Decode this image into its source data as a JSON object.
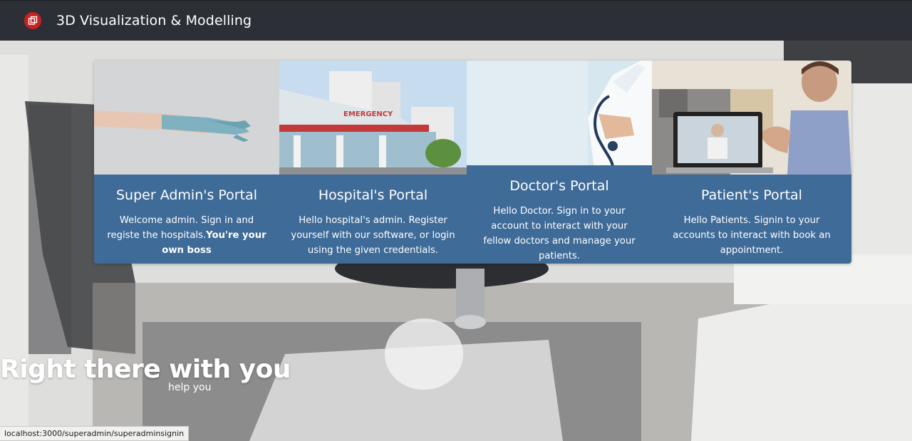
{
  "app": {
    "title": "3D Visualization & Modelling",
    "logo_icon": "cube-icon",
    "accent_color": "#cc1f1f"
  },
  "portals": [
    {
      "title": "Super Admin's Portal",
      "text": "Welcome admin. Sign in and registe the hospitals.",
      "text_bold": "You're your own boss",
      "image": "gloved-hand-image"
    },
    {
      "title": "Hospital's Portal",
      "text": "Hello hospital's admin. Register yourself with our software, or login using the given credentials.",
      "image": "hospital-building-image",
      "sign_text": "EMERGENCY"
    },
    {
      "title": "Doctor's Portal",
      "text": "Hello Doctor. Sign in to your account to interact with your fellow doctors and manage your patients.",
      "image": "doctor-stethoscope-image"
    },
    {
      "title": "Patient's Portal",
      "text": "Hello Patients. Signin to your accounts to interact with book an appointment.",
      "image": "patient-video-call-image"
    }
  ],
  "hero": {
    "tagline": "Right there with you",
    "subline": "help you"
  },
  "status_bar": {
    "url": "localhost:3000/superadmin/superadminsignin"
  },
  "colors": {
    "navbar": "#2c3036",
    "card_body": "#3f6b98"
  }
}
